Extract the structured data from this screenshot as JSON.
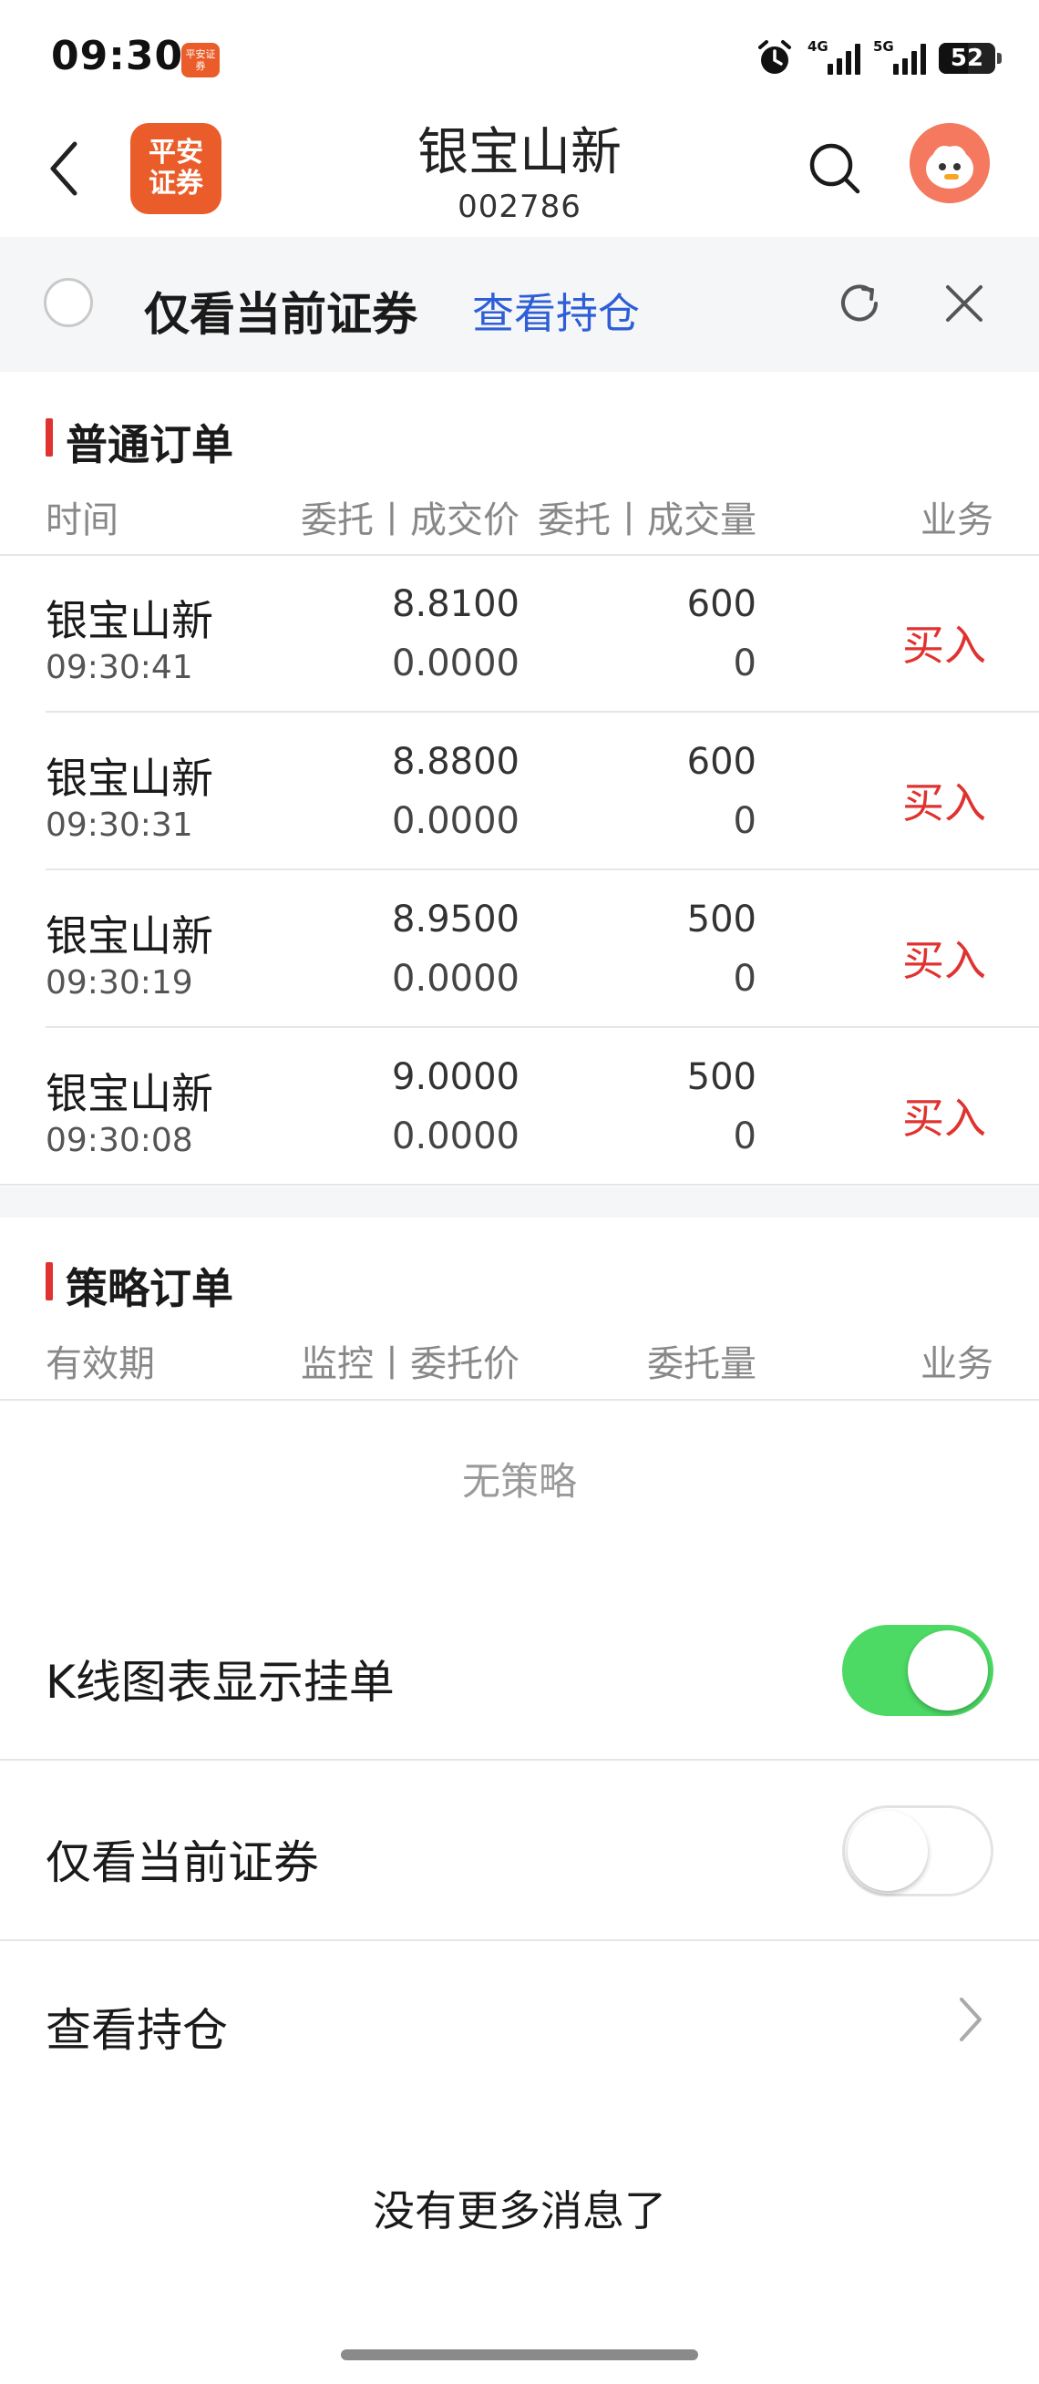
{
  "status_bar": {
    "time": "09:30",
    "app_badge": "平安证券",
    "network_1": "4G",
    "network_2": "5G",
    "battery": "52"
  },
  "header": {
    "brand_line1": "平安",
    "brand_line2": "证券",
    "title": "银宝山新",
    "code": "002786"
  },
  "filter_bar": {
    "label": "仅看当前证券",
    "link": "查看持仓"
  },
  "normal_orders": {
    "title": "普通订单",
    "col_time": "时间",
    "col_price": "委托丨成交价",
    "col_qty": "委托丨成交量",
    "col_action": "业务",
    "rows": [
      {
        "name": "银宝山新",
        "time": "09:30:41",
        "order_price": "8.8100",
        "deal_price": "0.0000",
        "order_qty": "600",
        "deal_qty": "0",
        "action": "买入"
      },
      {
        "name": "银宝山新",
        "time": "09:30:31",
        "order_price": "8.8800",
        "deal_price": "0.0000",
        "order_qty": "600",
        "deal_qty": "0",
        "action": "买入"
      },
      {
        "name": "银宝山新",
        "time": "09:30:19",
        "order_price": "8.9500",
        "deal_price": "0.0000",
        "order_qty": "500",
        "deal_qty": "0",
        "action": "买入"
      },
      {
        "name": "银宝山新",
        "time": "09:30:08",
        "order_price": "9.0000",
        "deal_price": "0.0000",
        "order_qty": "500",
        "deal_qty": "0",
        "action": "买入"
      }
    ]
  },
  "strategy_orders": {
    "title": "策略订单",
    "col_validity": "有效期",
    "col_monitor": "监控丨委托价",
    "col_qty": "委托量",
    "col_action": "业务",
    "empty": "无策略"
  },
  "settings": {
    "kline_label": "K线图表显示挂单",
    "kline_on": true,
    "current_only_label": "仅看当前证券",
    "current_only_on": false,
    "positions_label": "查看持仓"
  },
  "footer": {
    "text": "没有更多消息了"
  },
  "colors": {
    "accent_red": "#e0322f",
    "link_blue": "#2e5fd6",
    "brand_orange": "#ea5d2b",
    "toggle_green": "#4cd964"
  }
}
